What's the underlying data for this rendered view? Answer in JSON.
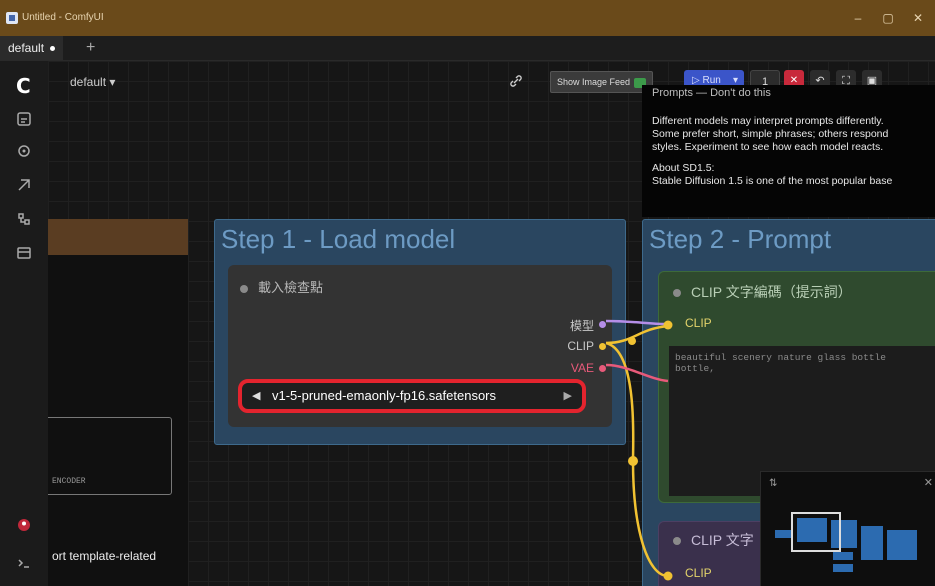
{
  "window": {
    "title": "Untitled - ComfyUI",
    "minimize": "–",
    "maximize": "▢",
    "close": "✕"
  },
  "tabs": [
    {
      "label": "default"
    }
  ],
  "new_tab": "+",
  "logo": "C",
  "workflow_name": "default ▾",
  "toolbar": {
    "image_feed_label": "Show Image Feed",
    "run_label": "Run",
    "run_caret": "▾",
    "batch_count": "1",
    "stop": "✕",
    "extra_icons": [
      "↶",
      "⛶",
      "▣"
    ]
  },
  "notes": {
    "header": "Prompts — Don't do this",
    "paragraphs": [
      "Different models may interpret prompts differently.",
      "Some prefer short, simple phrases; others respond",
      "styles. Experiment to see how each model reacts."
    ],
    "about_title": "About SD1.5:",
    "about_text": "Stable Diffusion 1.5 is one of the most popular base"
  },
  "left_panel": {
    "subtext": "ENCODER",
    "note": "ort template-related"
  },
  "groups": [
    {
      "title": "Step 1 - Load model"
    },
    {
      "title": "Step 2 - Prompt"
    }
  ],
  "checkpoint_node": {
    "title": "載入檢查點",
    "outputs": [
      {
        "label": "模型",
        "color": "#b58ee8"
      },
      {
        "label": "CLIP",
        "color": "#f1c232"
      },
      {
        "label": "VAE",
        "color": "#e85a7a"
      }
    ],
    "ckpt_name": "v1-5-pruned-emaonly-fp16.safetensors",
    "arrow_left": "◀",
    "arrow_right": "▶"
  },
  "clip_node": {
    "title": "CLIP 文字編碼（提示詞）",
    "input_label": "CLIP",
    "text": "beautiful scenery nature glass bottle\nbottle,"
  },
  "clip_node_2": {
    "title": "CLIP 文字",
    "input_label": "CLIP"
  },
  "minimap": {
    "header": "⇅",
    "close": "✕"
  },
  "colors": {
    "group": "#2a4660",
    "accent_red": "#e4242e",
    "clip_wire": "#f1c232",
    "model_wire": "#b58ee8",
    "vae_wire": "#e85a7a"
  }
}
